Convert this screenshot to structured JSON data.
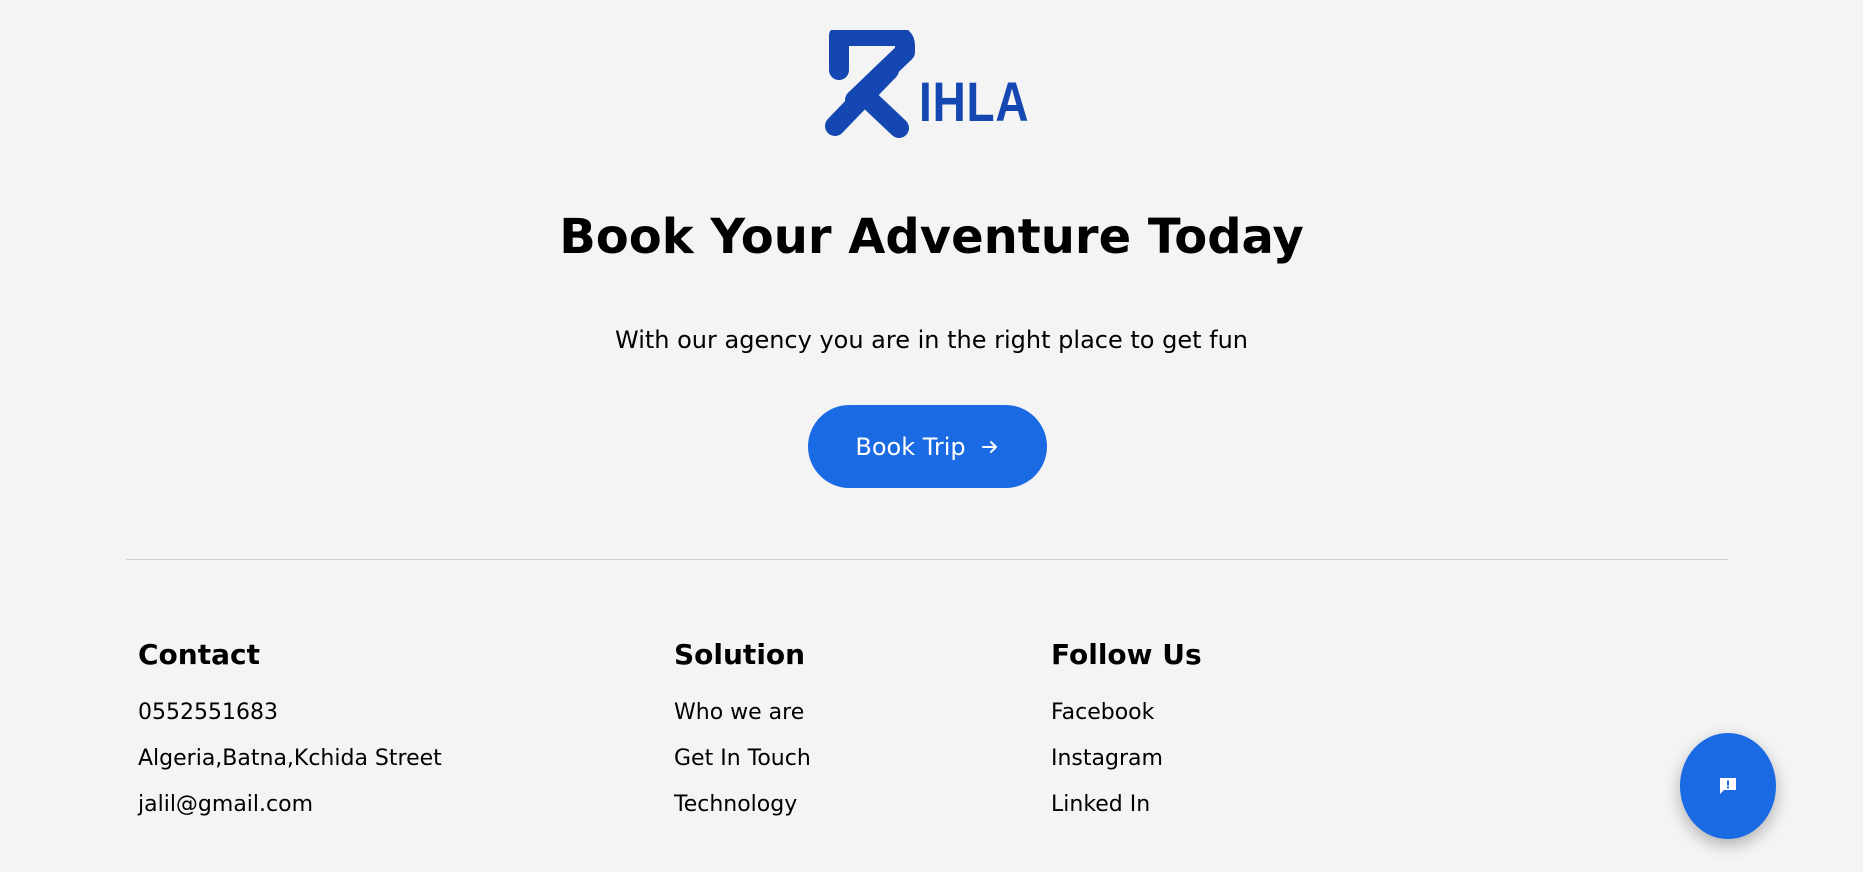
{
  "brand": {
    "logo_text": "IHLA",
    "accent_color": "#1a6ae3",
    "logo_color": "#1547b3"
  },
  "hero": {
    "title": "Book Your Adventure Today",
    "subtitle": "With our agency you are in the right place to get fun",
    "cta_label": "Book Trip",
    "cta_icon": "arrow-right-icon"
  },
  "footer": {
    "contact": {
      "heading": "Contact",
      "items": [
        "0552551683",
        "Algeria,Batna,Kchida Street",
        "jalil@gmail.com"
      ]
    },
    "solution": {
      "heading": "Solution",
      "items": [
        "Who we are",
        "Get In Touch",
        "Technology"
      ]
    },
    "follow": {
      "heading": "Follow Us",
      "items": [
        "Facebook",
        "Instagram",
        "Linked In"
      ]
    }
  },
  "feedback_button": {
    "icon": "feedback-icon"
  }
}
